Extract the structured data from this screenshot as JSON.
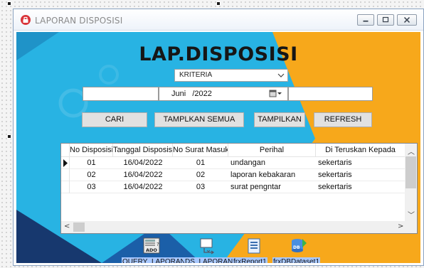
{
  "window": {
    "title": "LAPORAN DISPOSISI"
  },
  "form": {
    "heading": "LAP.DISPOSISI",
    "criteria_combo": {
      "value": "KRITERIA"
    },
    "search_left_value": "",
    "date_value": "Juni   /2022",
    "search_right_value": "",
    "buttons": {
      "cari": "CARI",
      "tampilkan_semua": "TAMPLKAN SEMUA",
      "tampilkan": "TAMPILKAN",
      "refresh": "REFRESH"
    }
  },
  "grid": {
    "columns": [
      "No Disposisi",
      "Tanggal Disposisi",
      "No Surat Masuk",
      "Perihal",
      "Di Teruskan Kepada"
    ],
    "rows": [
      [
        "01",
        "16/04/2022",
        "01",
        "undangan",
        "sekertaris"
      ],
      [
        "02",
        "16/04/2022",
        "02",
        "laporan kebakaran",
        "sekertaris"
      ],
      [
        "03",
        "16/04/2022",
        "03",
        "surat pengntar",
        "sekertaris"
      ]
    ],
    "current_row": 0
  },
  "components": [
    {
      "label": "QUERY_LAPORAN",
      "icon": "ado-query-icon",
      "badge": "ADO"
    },
    {
      "label": "DS_LAPORAN",
      "icon": "datasource-icon"
    },
    {
      "label": "frxReport1",
      "icon": "report-icon"
    },
    {
      "label": "frxDBDataset1",
      "icon": "db-dataset-icon",
      "badge": "DB"
    }
  ],
  "colors": {
    "background_blue": "#28b3e3",
    "accent_orange": "#f7a81b",
    "accent_navy": "#17386e",
    "selection": "#a8c8ff"
  }
}
